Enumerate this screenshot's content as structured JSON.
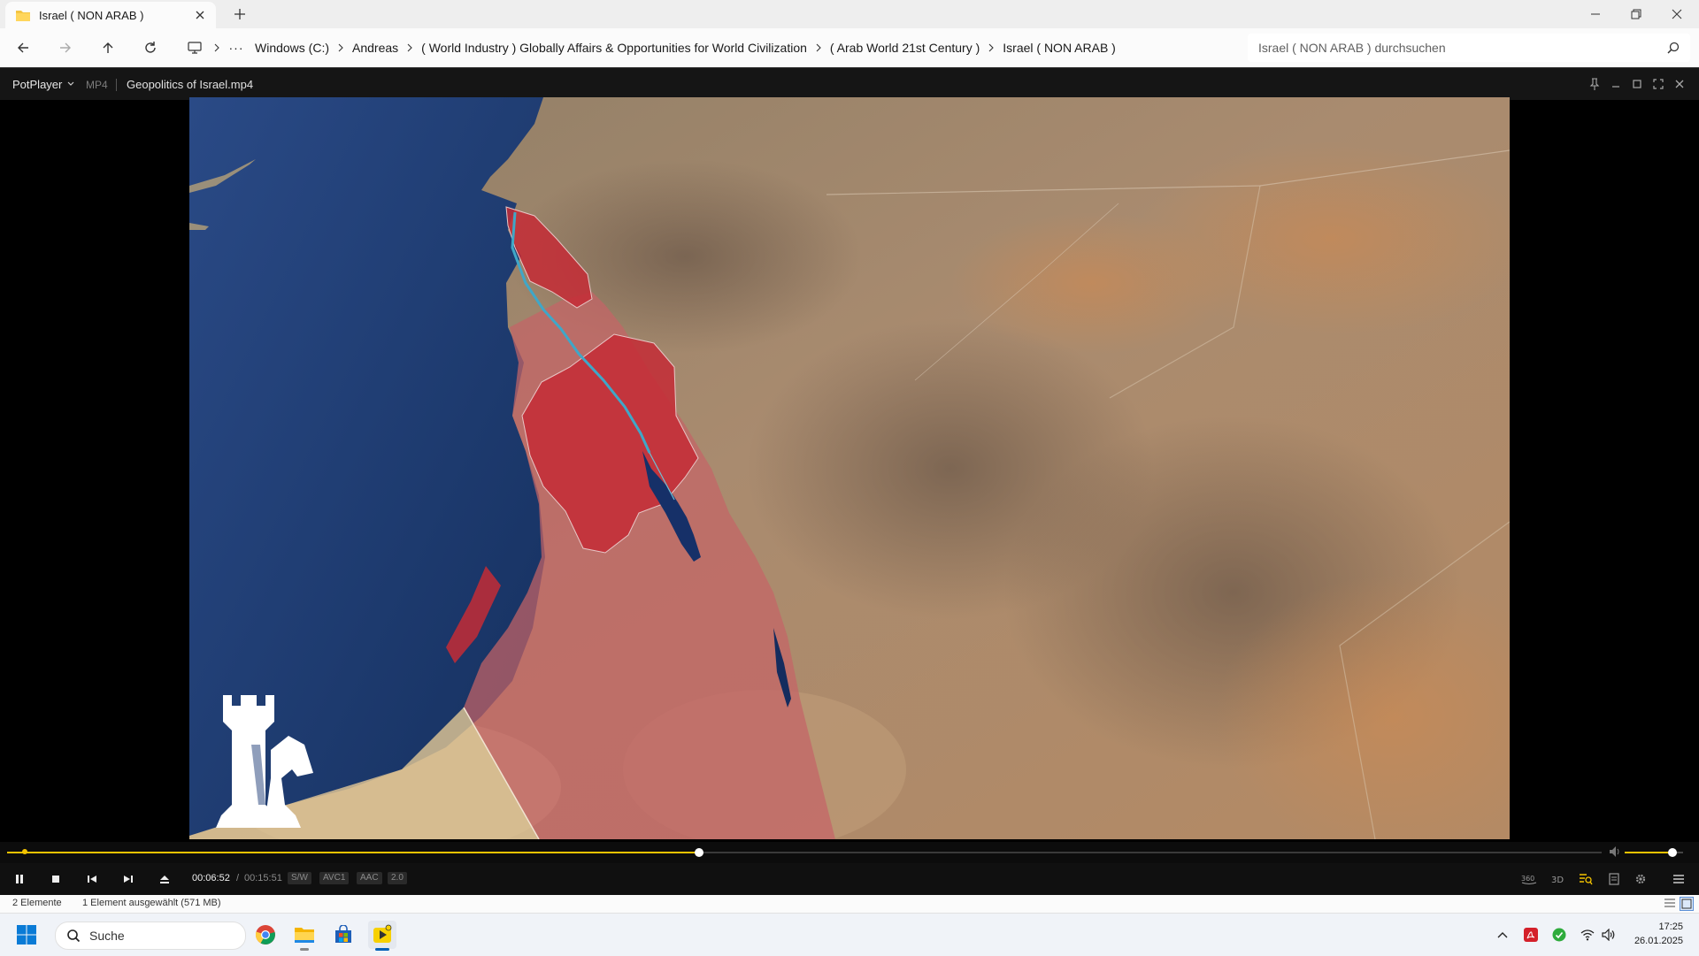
{
  "explorer": {
    "tab_title": "Israel ( NON ARAB )",
    "breadcrumb": [
      "Windows (C:)",
      "Andreas",
      "( World Industry ) Globally Affairs & Opportunities for World Civilization",
      "( Arab World 21st Century )",
      "Israel ( NON ARAB )"
    ],
    "search_placeholder": "Israel ( NON ARAB ) durchsuchen",
    "status_count": "2 Elemente",
    "status_selected": "1 Element ausgewählt (571 MB)"
  },
  "player": {
    "app_name": "PotPlayer",
    "format": "MP4",
    "file_name": "Geopolitics of Israel.mp4",
    "time_current": "00:06:52",
    "time_separator": "/",
    "time_total": "00:15:51",
    "tags": [
      "S/W",
      "AVC1",
      "AAC",
      "2.0"
    ],
    "progress_fraction": 0.434,
    "ab_marker_fraction": 0.011,
    "volume_fraction": 0.82,
    "state": "playing",
    "right_buttons": [
      "360-icon",
      "3d-icon",
      "playlist-search-icon",
      "chapter-icon",
      "settings-icon",
      "menu-icon"
    ]
  },
  "taskbar": {
    "search_placeholder": "Suche",
    "apps": [
      "chrome-icon",
      "file-explorer-icon",
      "microsoft-store-icon",
      "potplayer-icon"
    ],
    "time": "17:25",
    "date": "26.01.2025"
  },
  "colors": {
    "accent_yellow": "#f2c200",
    "sea": "#1f3d78",
    "highlight_red": "#c42b36",
    "desert": "#a9866a",
    "taskbar_blue": "#005fb8"
  }
}
